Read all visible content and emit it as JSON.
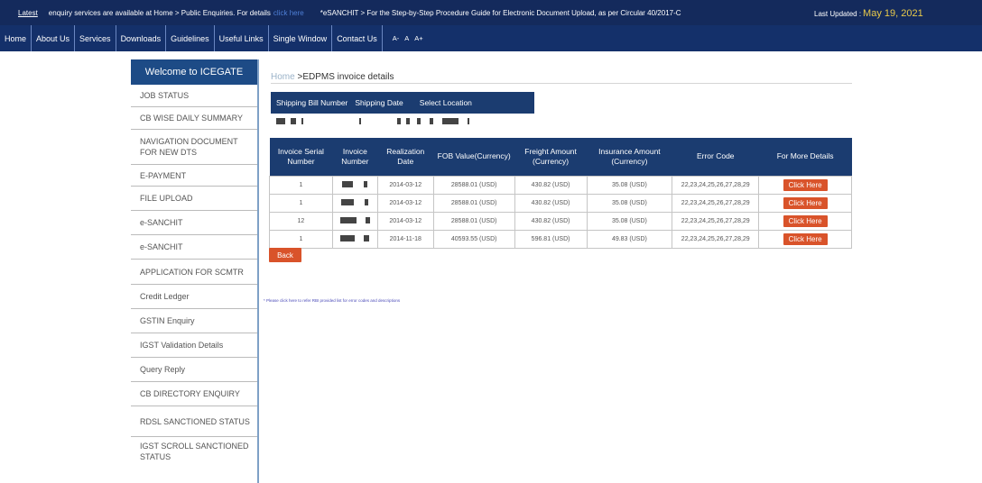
{
  "ticker": {
    "label": "Latest",
    "message1": "enquiry services are available at Home > Public Enquiries. For details",
    "link_text": "click here",
    "message2": "*eSANCHIT > For the Step-by-Step Procedure Guide for Electronic Document Upload, as per Circular 40/2017-C",
    "updated_label": "Last Updated :",
    "updated_date": "May 19, 2021"
  },
  "nav": {
    "items": [
      "Home",
      "About Us",
      "Services",
      "Downloads",
      "Guidelines",
      "Useful Links",
      "Single Window",
      "Contact Us"
    ],
    "font_controls": [
      "A-",
      "A",
      "A+"
    ]
  },
  "sidebar": {
    "welcome": "Welcome to ICEGATE",
    "items": [
      "JOB STATUS",
      "CB WISE DAILY SUMMARY",
      "NAVIGATION DOCUMENT FOR NEW DTS",
      "E-PAYMENT",
      "FILE UPLOAD",
      "e-SANCHIT",
      "e-SANCHIT",
      "APPLICATION FOR SCMTR",
      "Credit Ledger",
      "GSTIN Enquiry",
      "IGST Validation Details",
      "Query Reply",
      "CB DIRECTORY ENQUIRY",
      "RDSL SANCTIONED STATUS",
      "IGST SCROLL SANCTIONED STATUS"
    ]
  },
  "breadcrumb": {
    "home": "Home",
    "separator": " >",
    "current": "EDPMS invoice details"
  },
  "shipping": {
    "headers": [
      "Shipping Bill Number",
      "Shipping Date",
      "Select Location"
    ]
  },
  "invoice_table": {
    "headers": [
      "Invoice Serial Number",
      "Invoice Number",
      "Realization Date",
      "FOB Value(Currency)",
      "Freight Amount (Currency)",
      "Insurance Amount (Currency)",
      "Error Code",
      "For More Details"
    ],
    "rows": [
      {
        "serial": "1",
        "date": "2014-03-12",
        "fob": "28588.01 (USD)",
        "freight": "430.82 (USD)",
        "insurance": "35.08 (USD)",
        "error": "22,23,24,25,26,27,28,29",
        "action": "Click Here"
      },
      {
        "serial": "1",
        "date": "2014-03-12",
        "fob": "28588.01 (USD)",
        "freight": "430.82 (USD)",
        "insurance": "35.08 (USD)",
        "error": "22,23,24,25,26,27,28,29",
        "action": "Click Here"
      },
      {
        "serial": "12",
        "date": "2014-03-12",
        "fob": "28588.01 (USD)",
        "freight": "430.82 (USD)",
        "insurance": "35.08 (USD)",
        "error": "22,23,24,25,26,27,28,29",
        "action": "Click Here"
      },
      {
        "serial": "1",
        "date": "2014-11-18",
        "fob": "40593.55 (USD)",
        "freight": "596.81 (USD)",
        "insurance": "49.83 (USD)",
        "error": "22,23,24,25,26,27,28,29",
        "action": "Click Here"
      }
    ]
  },
  "back_label": "Back",
  "note": "* Please click here to refer RBI provided list for error codes and descriptions",
  "colors": {
    "ticker_bg": "#142a5c",
    "nav_bg": "#14306a",
    "table_header": "#1b3c70",
    "button": "#d9532a",
    "updated_date": "#e8c94a"
  }
}
